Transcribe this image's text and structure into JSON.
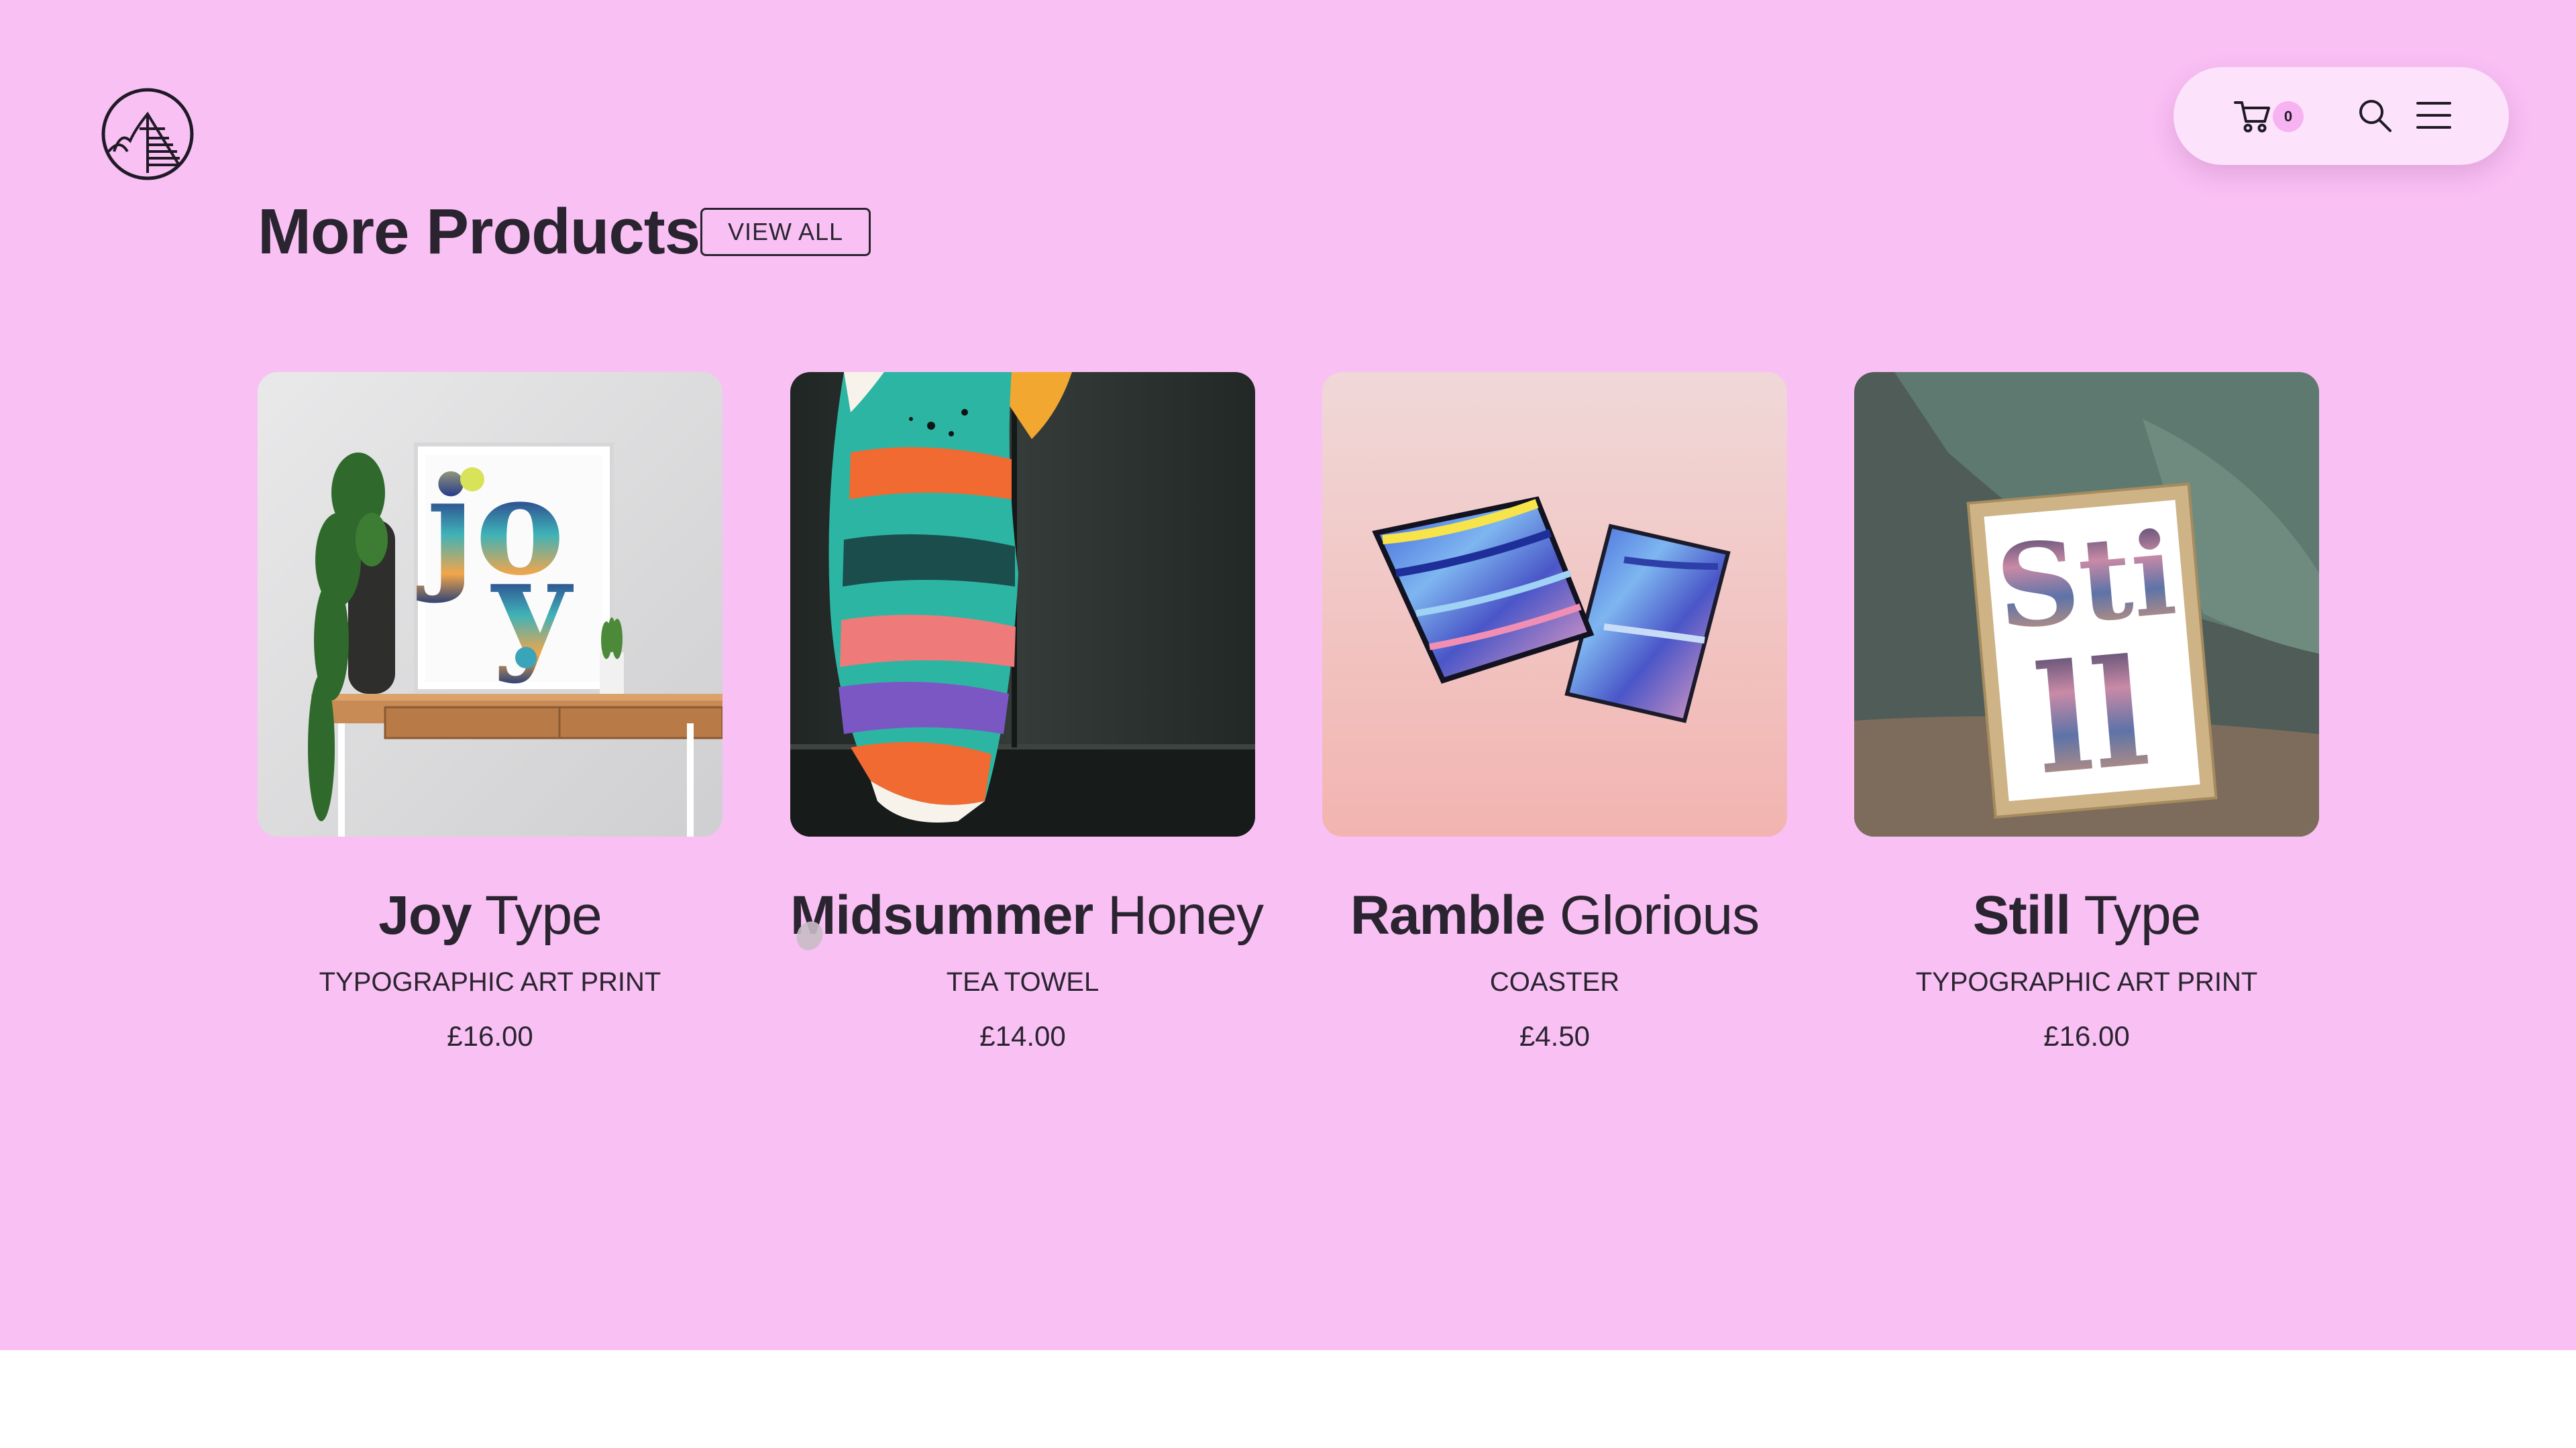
{
  "header": {
    "logo": "mountain-logo",
    "cart": {
      "icon": "cart-icon",
      "count": "0"
    },
    "search": {
      "icon": "search-icon"
    },
    "menu": {
      "icon": "hamburger-menu-icon"
    },
    "nav_background": "#fde2fb"
  },
  "section": {
    "title": "More Products",
    "view_all_label": "VIEW ALL"
  },
  "products": [
    {
      "name_bold": "Joy",
      "name_light": "Type",
      "category": "TYPOGRAPHIC ART PRINT",
      "price": "£16.00",
      "image": "joy-type-print-photo"
    },
    {
      "name_bold": "Midsummer",
      "name_light": "Honey",
      "category": "TEA TOWEL",
      "price": "£14.00",
      "image": "midsummer-honey-tea-towel-photo"
    },
    {
      "name_bold": "Ramble",
      "name_light": "Glorious",
      "category": "COASTER",
      "price": "£4.50",
      "image": "ramble-glorious-coaster-photo"
    },
    {
      "name_bold": "Still",
      "name_light": "Type",
      "category": "TYPOGRAPHIC ART PRINT",
      "price": "£16.00",
      "image": "still-type-print-photo"
    }
  ],
  "colors": {
    "page_background": "#f9c0f4",
    "footer_background": "#ffffff",
    "text": "#2a2430",
    "cart_badge": "#f7b3f1"
  }
}
